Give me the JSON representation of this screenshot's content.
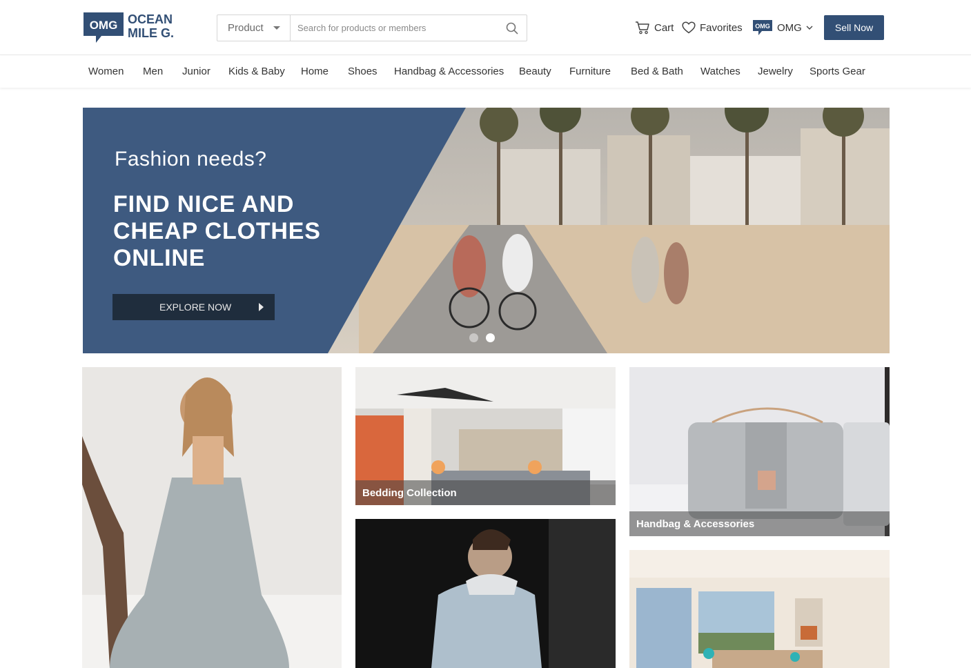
{
  "brand": {
    "badge": "OMG",
    "line1": "OCEAN",
    "line2": "MILE G.",
    "color": "#324f75"
  },
  "search": {
    "category": "Product",
    "placeholder": "Search for products or members"
  },
  "header": {
    "cart_label": "Cart",
    "favorites_label": "Favorites",
    "account_label": "OMG",
    "sell_label": "Sell Now"
  },
  "categories": [
    "Women",
    "Men",
    "Junior",
    "Kids & Baby",
    "Home",
    "Shoes",
    "Handbag & Accessories",
    "Beauty",
    "Furniture",
    "Bed & Bath",
    "Watches",
    "Jewelry",
    "Sports Gear"
  ],
  "banner": {
    "kicker": "Fashion needs?",
    "headline": "FIND NICE AND CHEAP CLOTHES ONLINE",
    "cta": "EXPLORE NOW",
    "slide_count": 2,
    "active_slide": 2,
    "panel_color": "#3e5a80"
  },
  "tiles": {
    "bedding": "Bedding Collection",
    "handbag": "Handbag & Accessories"
  }
}
